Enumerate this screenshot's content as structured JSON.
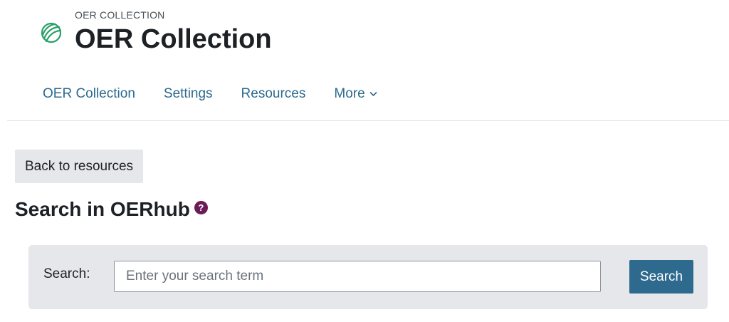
{
  "header": {
    "eyebrow": "OER COLLECTION",
    "title": "OER Collection",
    "logo_icon": "oer-collection-logo-icon"
  },
  "nav": {
    "items": [
      {
        "label": "OER Collection"
      },
      {
        "label": "Settings"
      },
      {
        "label": "Resources"
      },
      {
        "label": "More",
        "icon": "chevron-down-icon"
      }
    ]
  },
  "actions": {
    "back_label": "Back to resources"
  },
  "section": {
    "title": "Search in OERhub",
    "help_glyph": "?"
  },
  "search": {
    "label": "Search:",
    "value": "",
    "placeholder": "Enter your search term",
    "button_label": "Search"
  },
  "colors": {
    "link": "#2d6a8e",
    "primary_button": "#2d6a8e",
    "secondary_button": "#e5e7ea",
    "help_icon": "#6b1b57",
    "logo": "#2aa06a"
  }
}
